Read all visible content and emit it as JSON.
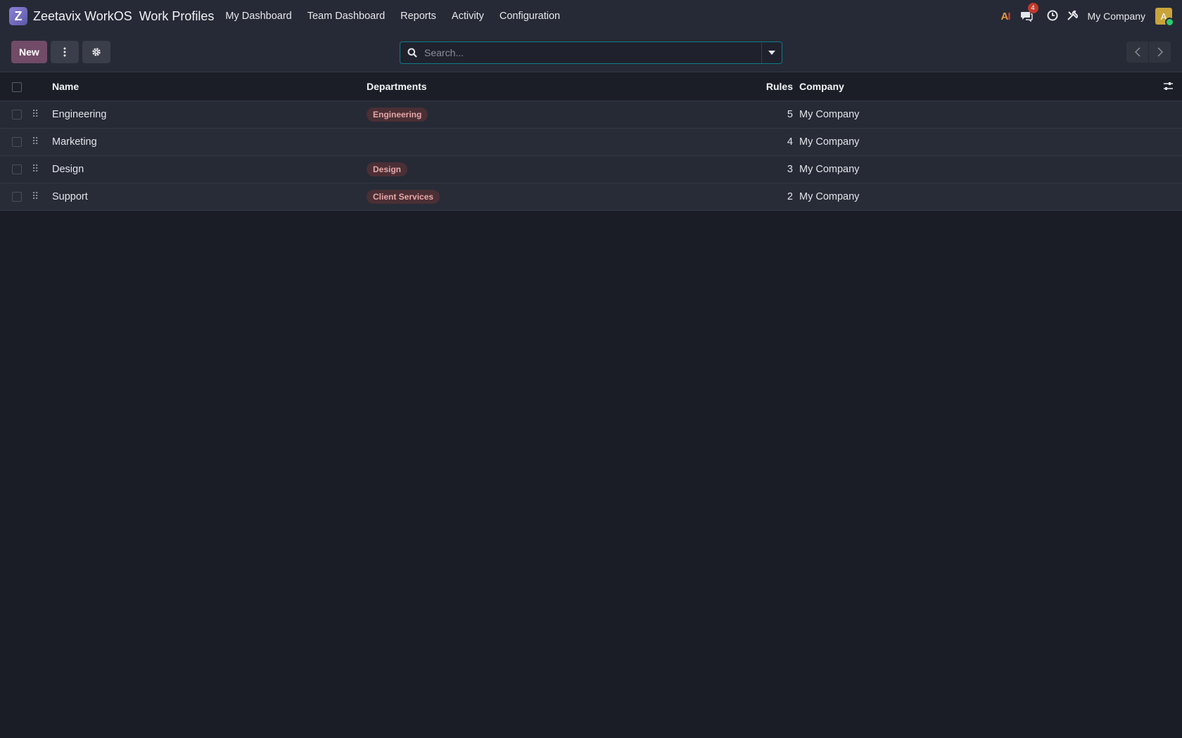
{
  "nav": {
    "logo_letter": "Z",
    "brand": "Zeetavix WorkOS",
    "module": "Work Profiles",
    "menu": [
      "My Dashboard",
      "Team Dashboard",
      "Reports",
      "Activity",
      "Configuration"
    ],
    "ai_label_a": "A",
    "ai_label_i": "I",
    "messages_count": "4",
    "company": "My Company",
    "avatar_letter": "A"
  },
  "controls": {
    "new_label": "New",
    "search_placeholder": "Search..."
  },
  "table": {
    "headers": {
      "name": "Name",
      "departments": "Departments",
      "rules": "Rules",
      "company": "Company"
    },
    "rows": [
      {
        "name": "Engineering",
        "department": "Engineering",
        "rules": "5",
        "company": "My Company"
      },
      {
        "name": "Marketing",
        "department": "",
        "rules": "4",
        "company": "My Company"
      },
      {
        "name": "Design",
        "department": "Design",
        "rules": "3",
        "company": "My Company"
      },
      {
        "name": "Support",
        "department": "Client Services",
        "rules": "2",
        "company": "My Company"
      }
    ]
  },
  "colors": {
    "accent": "#714b67",
    "search_border": "#0d7c8a",
    "tag_bg": "#4a2f35",
    "tag_text": "#e6a7a8"
  }
}
